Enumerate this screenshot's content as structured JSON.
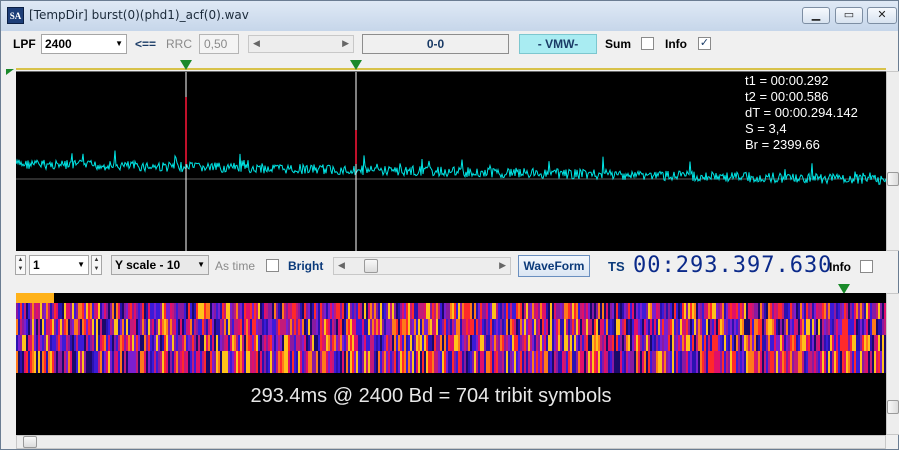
{
  "window": {
    "icon_text": "SA",
    "title": "[TempDir] burst(0)(phd1)_acf(0).wav",
    "min_icon": "minimize-icon",
    "max_icon": "maximize-icon",
    "close_icon": "close-icon"
  },
  "toolbar": {
    "lpf_label": "LPF",
    "lpf_value": "2400",
    "arrow_label": "<==",
    "rrc_label": "RRC",
    "rrc_value": "0,50",
    "range_display": "0-0",
    "vmw_button": "- VMW-",
    "sum_label": "Sum",
    "sum_checked": false,
    "info_label": "Info",
    "info_checked": true
  },
  "waveform": {
    "readout": {
      "t1": "t1 = 00:00.292",
      "t2": "t2 = 00:00.586",
      "dT": "dT = 00:00.294.142",
      "S": "S = 3,4",
      "Br": "Br = 2399.66"
    },
    "colors": {
      "trace": "#00e5e5",
      "marker": "#ffffff",
      "marker_hot": "#c0102a",
      "grid": "#5a5a5a"
    }
  },
  "controls": {
    "channel_value": "1",
    "yscale_value": "Y scale - 10",
    "as_time_label": "As time",
    "bright_label": "Bright",
    "bright_checked": false,
    "waveform_button": "WaveForm",
    "ts_label": "TS",
    "ts_value": "00:293.397.630",
    "info_label": "Info",
    "info_checked": false
  },
  "spectrogram": {
    "caption": "293.4ms @ 2400 Bd = 704 tribit symbols"
  }
}
